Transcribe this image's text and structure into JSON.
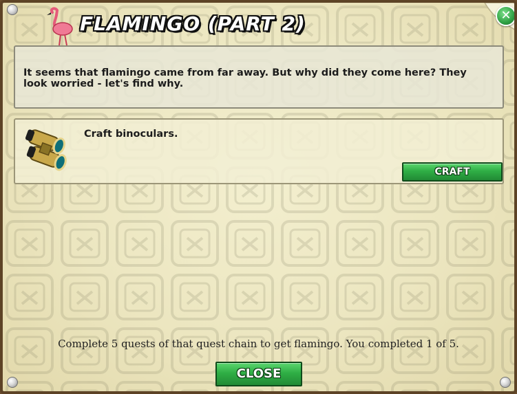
{
  "dialog": {
    "title": "FLAMINGO (PART 2)",
    "close_icon": "close-x-icon",
    "description": "It seems that flamingo came from far away. But why did they come here? They look worried - let's find why.",
    "task": {
      "icon": "binoculars-icon",
      "text": "Craft binoculars.",
      "button_label": "CRAFT"
    },
    "summary": "Complete 5 quests of that quest chain to get flamingo. You completed 1 of 5.",
    "close_label": "CLOSE"
  },
  "colors": {
    "button_green": "#2fae45",
    "panel": "#ece6c0",
    "frame": "#5d4326"
  }
}
